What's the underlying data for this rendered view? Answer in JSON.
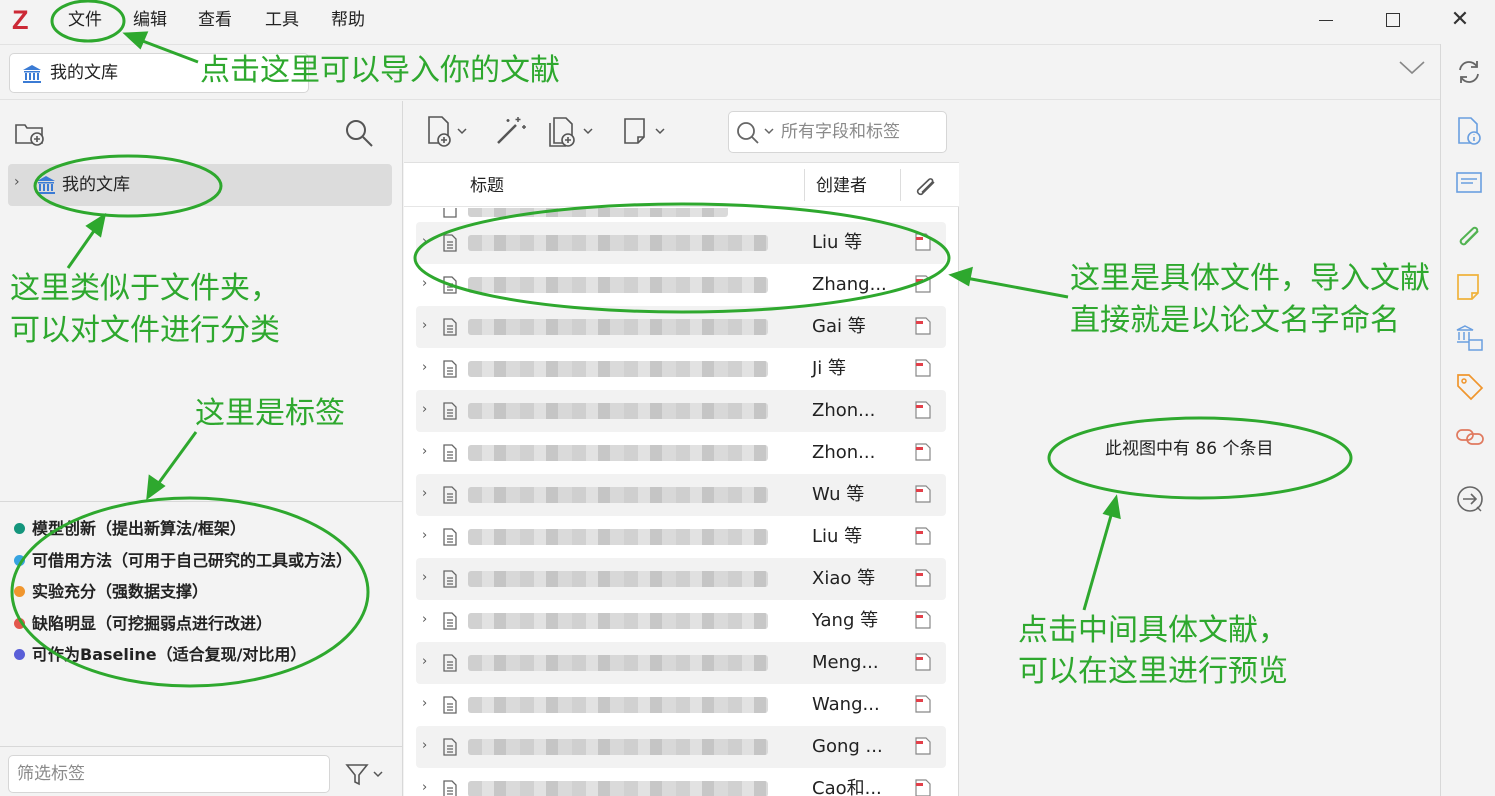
{
  "app": {
    "logo_text": "Z"
  },
  "menu": {
    "items": [
      "文件",
      "编辑",
      "查看",
      "工具",
      "帮助"
    ]
  },
  "window": {
    "close_glyph": "✕"
  },
  "tab": {
    "library_name": "我的文库"
  },
  "collections": {
    "root_label": "我的文库"
  },
  "tags": [
    {
      "label": "模型创新（提出新算法/框架）",
      "color": "#14957c"
    },
    {
      "label": "可借用方法（可用于自己研究的工具或方法）",
      "color": "#36a3e0"
    },
    {
      "label": "实验充分（强数据支撑）",
      "color": "#f0962e"
    },
    {
      "label": "缺陷明显（可挖掘弱点进行改进）",
      "color": "#e2574c"
    },
    {
      "label": "可作为Baseline（适合复现/对比用）",
      "color": "#5a5fd8"
    }
  ],
  "tag_filter": {
    "placeholder": "筛选标签"
  },
  "search": {
    "placeholder": "所有字段和标签"
  },
  "columns": {
    "title": "标题",
    "creator": "创建者"
  },
  "items": [
    {
      "creator": "Liu 等"
    },
    {
      "creator": "Zhang..."
    },
    {
      "creator": "Gai 等"
    },
    {
      "creator": "Ji 等"
    },
    {
      "creator": "Zhon..."
    },
    {
      "creator": "Zhon..."
    },
    {
      "creator": "Wu 等"
    },
    {
      "creator": "Liu 等"
    },
    {
      "creator": "Xiao 等"
    },
    {
      "creator": "Yang 等"
    },
    {
      "creator": "Meng..."
    },
    {
      "creator": "Wang..."
    },
    {
      "creator": "Gong ..."
    },
    {
      "creator": "Cao和..."
    }
  ],
  "item_pane": {
    "count_text": "此视图中有 86 个条目"
  },
  "annotations": {
    "import": "点击这里可以导入你的文献",
    "folder_line1": "这里类似于文件夹，",
    "folder_line2": "可以对文件进行分类",
    "tags": "这里是标签",
    "files_line1": "这里是具体文件，导入文献",
    "files_line2": "直接就是以论文名字命名",
    "preview_line1": "点击中间具体文献，",
    "preview_line2": "可以在这里进行预览"
  },
  "colors": {
    "annotation": "#2ea82e",
    "accent_blue": "#3b7bd4",
    "accent_orange": "#f0962e"
  }
}
